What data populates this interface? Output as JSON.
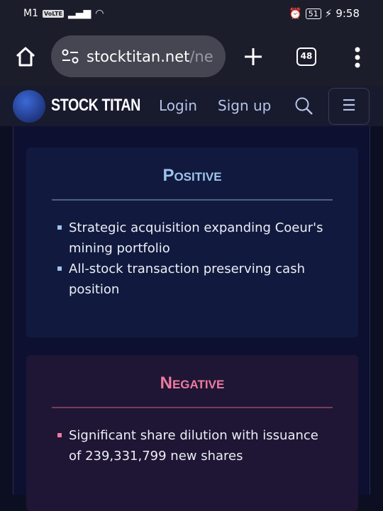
{
  "status_bar": {
    "carrier": "M1",
    "volte": "VoLTE",
    "battery": "51",
    "time": "9:58"
  },
  "browser": {
    "url_host": "stocktitan.net",
    "url_path": "/ne",
    "tab_count": "48"
  },
  "nav": {
    "brand": "STOCK TITAN",
    "login": "Login",
    "signup": "Sign up"
  },
  "positive": {
    "title": "Positive",
    "items": [
      "Strategic acquisition expanding Coeur's mining portfolio",
      "All-stock transaction preserving cash position"
    ]
  },
  "negative": {
    "title": "Negative",
    "items": [
      "Significant share dilution with issuance of 239,331,799 new shares"
    ]
  },
  "colors": {
    "positive": "#9dc3ec",
    "negative": "#f07aa0"
  }
}
